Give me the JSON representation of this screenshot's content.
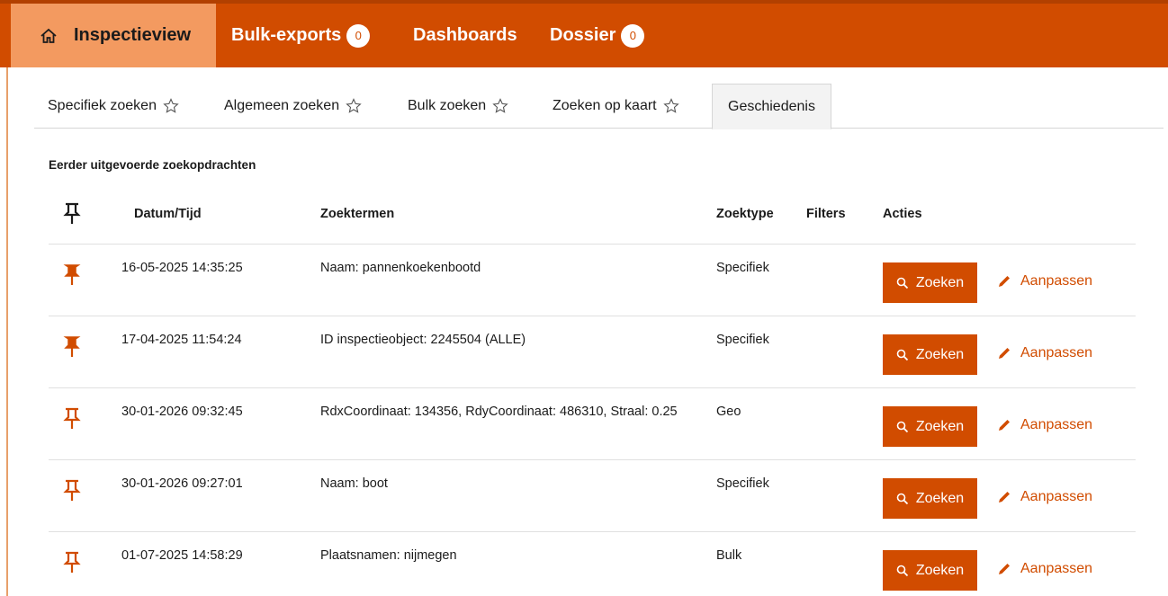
{
  "nav": {
    "home_icon": "home-icon",
    "items": [
      {
        "label": "Inspectieview"
      },
      {
        "label": "Bulk-exports",
        "badge": "0"
      },
      {
        "label": "Dashboards"
      },
      {
        "label": "Dossier",
        "badge": "0"
      }
    ]
  },
  "tabs": [
    {
      "label": "Specifiek zoeken",
      "icon": "star-icon"
    },
    {
      "label": "Algemeen zoeken",
      "icon": "star-icon"
    },
    {
      "label": "Bulk zoeken",
      "icon": "star-icon"
    },
    {
      "label": "Zoeken op kaart",
      "icon": "star-icon"
    },
    {
      "label": "Geschiedenis",
      "selected": true
    }
  ],
  "section_title": "Eerder uitgevoerde zoekopdrachten",
  "table": {
    "pin_header_icon": "pin-icon",
    "columns": [
      "Datum/Tijd",
      "Zoektermen",
      "Zoektype",
      "Filters",
      "Acties"
    ],
    "rows": [
      {
        "pinned": true,
        "datetime": "16-05-2025 14:35:25",
        "terms": "Naam: pannenkoekenbootd",
        "type": "Specifiek",
        "filters": ""
      },
      {
        "pinned": true,
        "datetime": "17-04-2025 11:54:24",
        "terms": "ID inspectieobject: 2245504 (ALLE)",
        "type": "Specifiek",
        "filters": ""
      },
      {
        "pinned": false,
        "datetime": "30-01-2026 09:32:45",
        "terms": "RdxCoordinaat: 134356, RdyCoordinaat: 486310, Straal: 0.25",
        "type": "Geo",
        "filters": ""
      },
      {
        "pinned": false,
        "datetime": "30-01-2026 09:27:01",
        "terms": "Naam: boot",
        "type": "Specifiek",
        "filters": ""
      },
      {
        "pinned": false,
        "datetime": "01-07-2025 14:58:29",
        "terms": "Plaatsnamen: nijmegen",
        "type": "Bulk",
        "filters": ""
      }
    ],
    "search_label": "Zoeken",
    "edit_label": "Aanpassen"
  },
  "colors": {
    "accent": "#d14c00",
    "accent_light": "#f39a60"
  }
}
